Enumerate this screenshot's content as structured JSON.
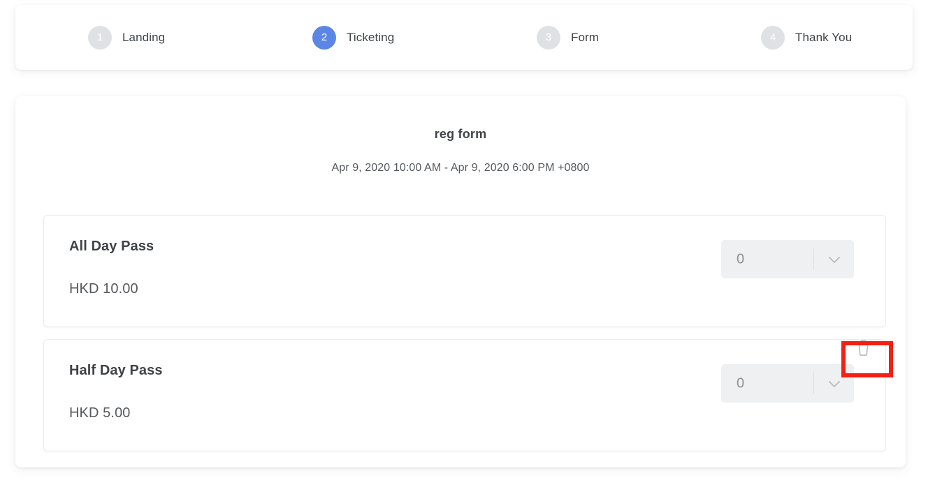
{
  "stepper": {
    "steps": [
      {
        "number": "1",
        "label": "Landing",
        "state": "inactive"
      },
      {
        "number": "2",
        "label": "Ticketing",
        "state": "active"
      },
      {
        "number": "3",
        "label": "Form",
        "state": "inactive"
      },
      {
        "number": "4",
        "label": "Thank You",
        "state": "inactive"
      }
    ],
    "active_color": "#5b86e5",
    "inactive_color": "#dfe1e5"
  },
  "event": {
    "title": "reg form",
    "date_range": "Apr 9, 2020 10:00 AM - Apr 9, 2020 6:00 PM +0800"
  },
  "tickets": [
    {
      "name": "All Day Pass",
      "price": "HKD 10.00",
      "quantity": "0",
      "quantity_icon": "chevron-down-icon",
      "has_delete": false
    },
    {
      "name": "Half Day Pass",
      "price": "HKD 5.00",
      "quantity": "0",
      "quantity_icon": "chevron-down-icon",
      "has_delete": true,
      "delete_icon": "trash-icon"
    }
  ],
  "annotation": {
    "target": "delete-ticket-button",
    "color": "#f32013"
  }
}
